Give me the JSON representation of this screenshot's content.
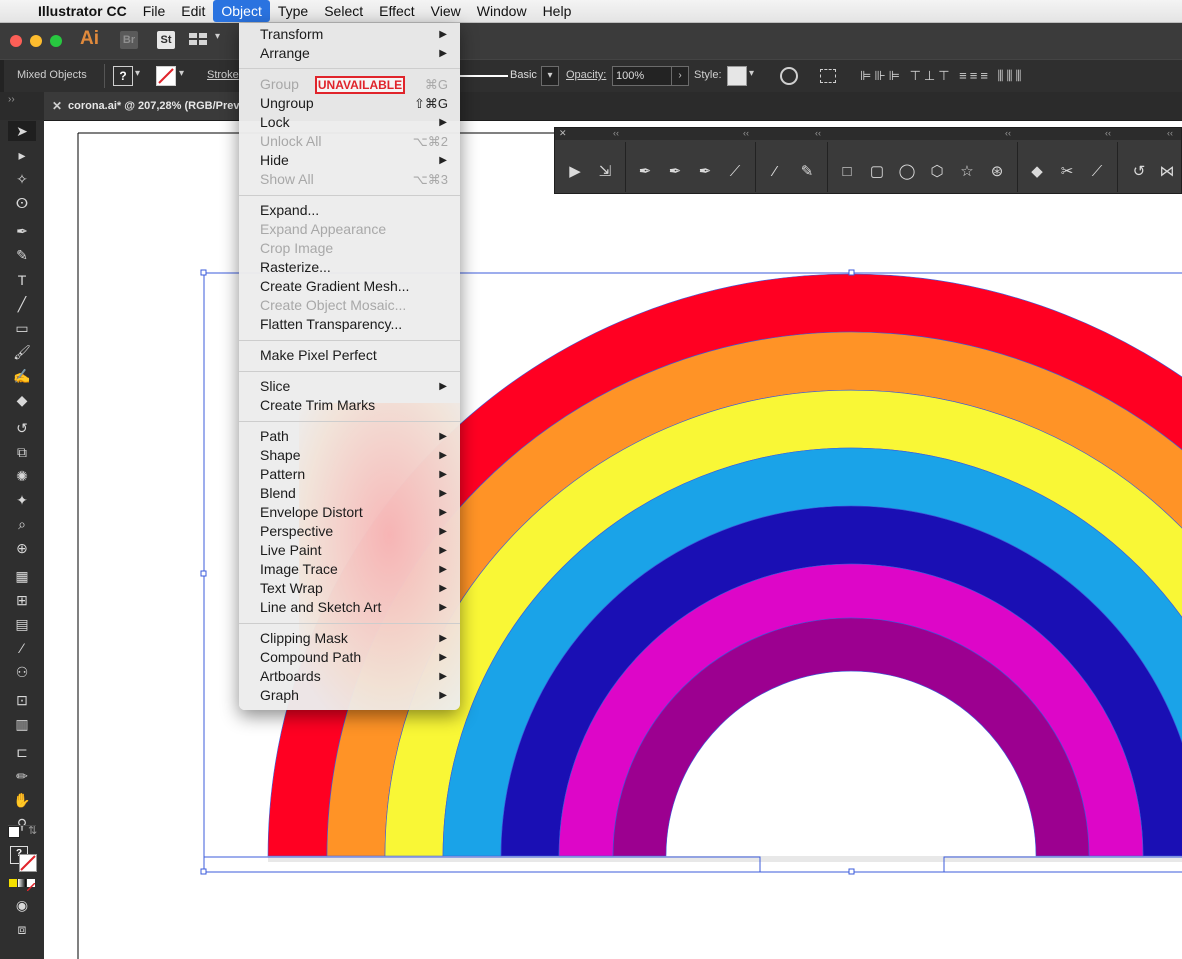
{
  "menubar": {
    "apple_icon": "apple-logo-icon",
    "app_name": "Illustrator CC",
    "items": [
      "File",
      "Edit",
      "Object",
      "Type",
      "Select",
      "Effect",
      "View",
      "Window",
      "Help"
    ],
    "active": "Object"
  },
  "apphead": {
    "logo": "Ai",
    "br": "Br",
    "st": "St"
  },
  "control": {
    "selection": "Mixed Objects",
    "fill_unknown": "?",
    "stroke_label": "Stroke",
    "brush": "Basic",
    "opacity_label": "Opacity:",
    "opacity_value": "100%",
    "style_label": "Style:"
  },
  "document": {
    "tab_title": "corona.ai* @ 207,28% (RGB/Preview)"
  },
  "object_menu": {
    "unavailable_badge": "UNAVAILABLE",
    "items": [
      {
        "label": "Transform",
        "arrow": "▶"
      },
      {
        "label": "Arrange",
        "arrow": "▶"
      },
      {
        "label": "Group",
        "shortcut": "⌘G"
      },
      {
        "label": "Ungroup",
        "shortcut": "⇧⌘G"
      },
      {
        "label": "Lock",
        "arrow": "▶"
      },
      {
        "label": "Unlock All",
        "shortcut": "⌥⌘2"
      },
      {
        "label": "Hide",
        "arrow": "▶"
      },
      {
        "label": "Show All",
        "shortcut": "⌥⌘3"
      },
      {
        "label": "Expand..."
      },
      {
        "label": "Expand Appearance"
      },
      {
        "label": "Crop Image"
      },
      {
        "label": "Rasterize..."
      },
      {
        "label": "Create Gradient Mesh..."
      },
      {
        "label": "Create Object Mosaic..."
      },
      {
        "label": "Flatten Transparency..."
      },
      {
        "label": "Make Pixel Perfect"
      },
      {
        "label": "Slice",
        "arrow": "▶"
      },
      {
        "label": "Create Trim Marks"
      },
      {
        "label": "Path",
        "arrow": "▶"
      },
      {
        "label": "Shape",
        "arrow": "▶"
      },
      {
        "label": "Pattern",
        "arrow": "▶"
      },
      {
        "label": "Blend",
        "arrow": "▶"
      },
      {
        "label": "Envelope Distort",
        "arrow": "▶"
      },
      {
        "label": "Perspective",
        "arrow": "▶"
      },
      {
        "label": "Live Paint",
        "arrow": "▶"
      },
      {
        "label": "Image Trace",
        "arrow": "▶"
      },
      {
        "label": "Text Wrap",
        "arrow": "▶"
      },
      {
        "label": "Line and Sketch Art",
        "arrow": "▶"
      },
      {
        "label": "Clipping Mask",
        "arrow": "▶"
      },
      {
        "label": "Compound Path",
        "arrow": "▶"
      },
      {
        "label": "Artboards",
        "arrow": "▶"
      },
      {
        "label": "Graph",
        "arrow": "▶"
      }
    ]
  },
  "colors": {
    "rainbow": [
      "#ff0022",
      "#ff9326",
      "#f9f736",
      "#1aa3e8",
      "#1a0fb4",
      "#dd06c8",
      "#9c0090"
    ],
    "menu_highlight": "#2a73e0",
    "unavailable": "#e0242b",
    "selection": "#3b5bdb"
  }
}
